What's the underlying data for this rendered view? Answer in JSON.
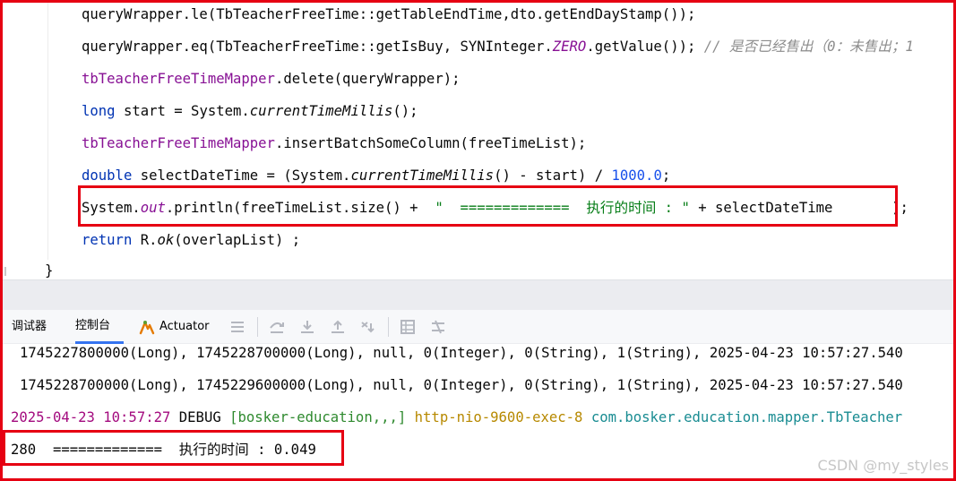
{
  "editor": {
    "lines": [
      {
        "segments": [
          {
            "t": "queryWrapper.le(TbTeacherFreeTime::getTableEndTime,dto.getEndDayStamp());",
            "c": ""
          }
        ]
      },
      {
        "segments": [
          {
            "t": "queryWrapper.eq(TbTeacherFreeTime::getIsBuy, SYNInteger.",
            "c": ""
          },
          {
            "t": "ZERO",
            "c": "f i"
          },
          {
            "t": ".getValue()); ",
            "c": ""
          },
          {
            "t": "// 是否已经售出（0：未售出；1",
            "c": "c"
          }
        ]
      },
      {
        "segments": [
          {
            "t": "tbTeacherFreeTimeMapper",
            "c": "f"
          },
          {
            "t": ".delete(queryWrapper);",
            "c": ""
          }
        ]
      },
      {
        "segments": [
          {
            "t": "long",
            "c": "k"
          },
          {
            "t": " start = System.",
            "c": ""
          },
          {
            "t": "currentTimeMillis",
            "c": "i"
          },
          {
            "t": "();",
            "c": ""
          }
        ]
      },
      {
        "segments": [
          {
            "t": "tbTeacherFreeTimeMapper",
            "c": "f"
          },
          {
            "t": ".insertBatchSomeColumn(freeTimeList);",
            "c": ""
          }
        ]
      },
      {
        "segments": [
          {
            "t": "double",
            "c": "k"
          },
          {
            "t": " selectDateTime = (System.",
            "c": ""
          },
          {
            "t": "currentTimeMillis",
            "c": "i"
          },
          {
            "t": "() - start) / ",
            "c": ""
          },
          {
            "t": "1000.0",
            "c": "n"
          },
          {
            "t": ";",
            "c": ""
          }
        ]
      },
      {
        "segments": [
          {
            "t": "System.",
            "c": ""
          },
          {
            "t": "out",
            "c": "f i"
          },
          {
            "t": ".println(freeTimeList.size() +  ",
            "c": ""
          },
          {
            "t": "\"  =============  执行的时间 : \"",
            "c": "s"
          },
          {
            "t": " + selectDateTime       );",
            "c": ""
          }
        ]
      },
      {
        "segments": [
          {
            "t": "return",
            "c": "k"
          },
          {
            "t": " R.",
            "c": ""
          },
          {
            "t": "ok",
            "c": "i"
          },
          {
            "t": "(overlapList) ;",
            "c": ""
          }
        ]
      }
    ],
    "closing_brace": "}"
  },
  "toolbar": {
    "tabs": [
      {
        "label": "调试器"
      },
      {
        "label": "控制台"
      },
      {
        "label": "Actuator"
      }
    ],
    "icons": [
      "menu-icon",
      "step-over-icon",
      "step-into-icon",
      "step-out-icon",
      "run-to-cursor-icon",
      "table-icon",
      "settings-icon"
    ]
  },
  "console": {
    "lines": [
      "1745227800000(Long), 1745228700000(Long), null, 0(Integer), 0(String), 1(String), 2025-04-23 10:57:27.540",
      "1745228700000(Long), 1745229600000(Long), null, 0(Integer), 0(String), 1(String), 2025-04-23 10:57:27.540"
    ],
    "log": {
      "time": "2025-04-23 10:57:27",
      "level": " DEBUG ",
      "app": "[bosker-education,,,]",
      "thread": " http-nio-9600-exec-8 ",
      "cls": "com.bosker.education.mapper.TbTeacher"
    },
    "output": "280  =============  执行的时间 : 0.049"
  },
  "watermark": "CSDN @my_styles",
  "colors": {
    "highlight": "#e60012",
    "active_tab": "#3574f0"
  }
}
